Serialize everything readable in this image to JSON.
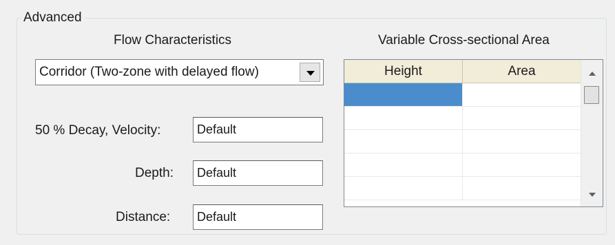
{
  "group": {
    "title": "Advanced"
  },
  "flow": {
    "title": "Flow Characteristics",
    "selected": "Corridor (Two-zone with delayed flow)"
  },
  "fields": {
    "decay_label": "50 % Decay, Velocity:",
    "decay_value": "Default",
    "depth_label": "Depth:",
    "depth_value": "Default",
    "distance_label": "Distance:",
    "distance_value": "Default"
  },
  "cross_section": {
    "title": "Variable Cross-sectional Area",
    "columns": [
      "Height",
      "Area"
    ],
    "rows": [
      [
        "",
        ""
      ],
      [
        "",
        ""
      ],
      [
        "",
        ""
      ],
      [
        "",
        ""
      ],
      [
        "",
        ""
      ]
    ]
  },
  "colors": {
    "selection": "#4a8ccc",
    "header": "#f1edd9"
  },
  "icons": {
    "dropdown": "chevron-down-icon",
    "scroll_up": "scroll-up-arrow-icon",
    "scroll_down": "scroll-down-arrow-icon"
  }
}
